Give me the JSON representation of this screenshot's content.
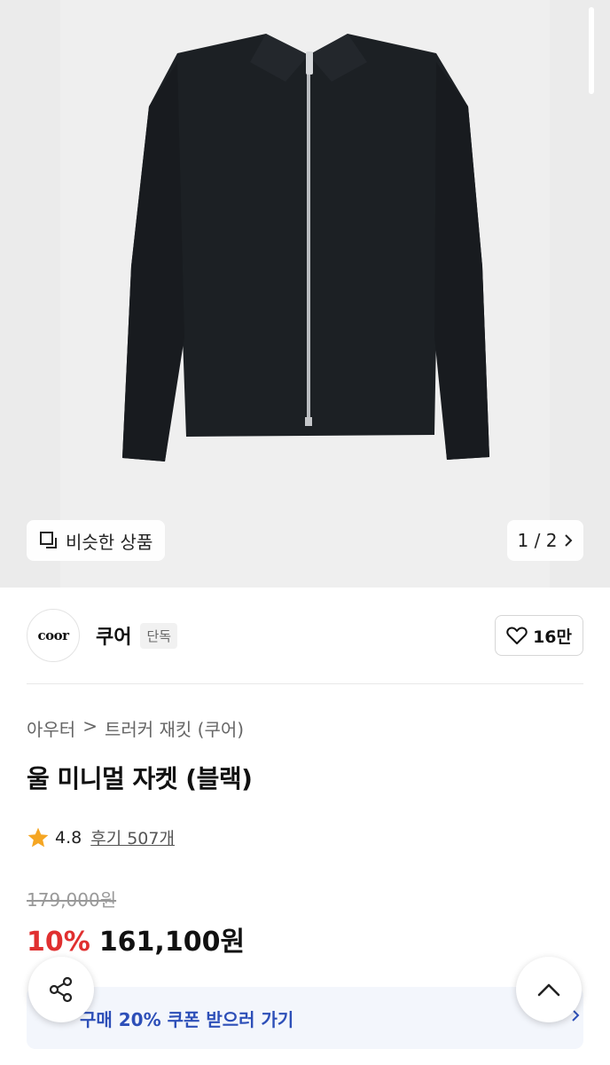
{
  "gallery": {
    "similar_label": "비슷한 상품",
    "pager": "1 / 2",
    "scroll_position": 0.0
  },
  "brand": {
    "logo_text": "coor",
    "name": "쿠어",
    "badge": "단독",
    "likes": "16만"
  },
  "breadcrumb": {
    "category": "아우터",
    "separator": ">",
    "subcategory": "트러커 재킷 (쿠어)"
  },
  "product": {
    "title": "울 미니멀 자켓 (블랙)",
    "rating": "4.8",
    "reviews": "후기 507개",
    "original_price": "179,000원",
    "discount": "10%",
    "sale_price": "161,100원"
  },
  "coupon": {
    "label": "구매 20% 쿠폰 받으러 가기"
  },
  "icons": {
    "similar": "similar-products-icon",
    "pager_next": "chevron-right-icon",
    "like": "heart-outline-icon",
    "star": "star-icon",
    "share": "share-icon",
    "scroll_top": "chevron-up-icon",
    "coupon_arrow": "chevron-right-icon"
  },
  "colors": {
    "discount": "#e03030",
    "coupon_text": "#2d4fb8",
    "coupon_bg": "#f3f6fc",
    "star": "#f5a623",
    "jacket": "#1c2024"
  }
}
